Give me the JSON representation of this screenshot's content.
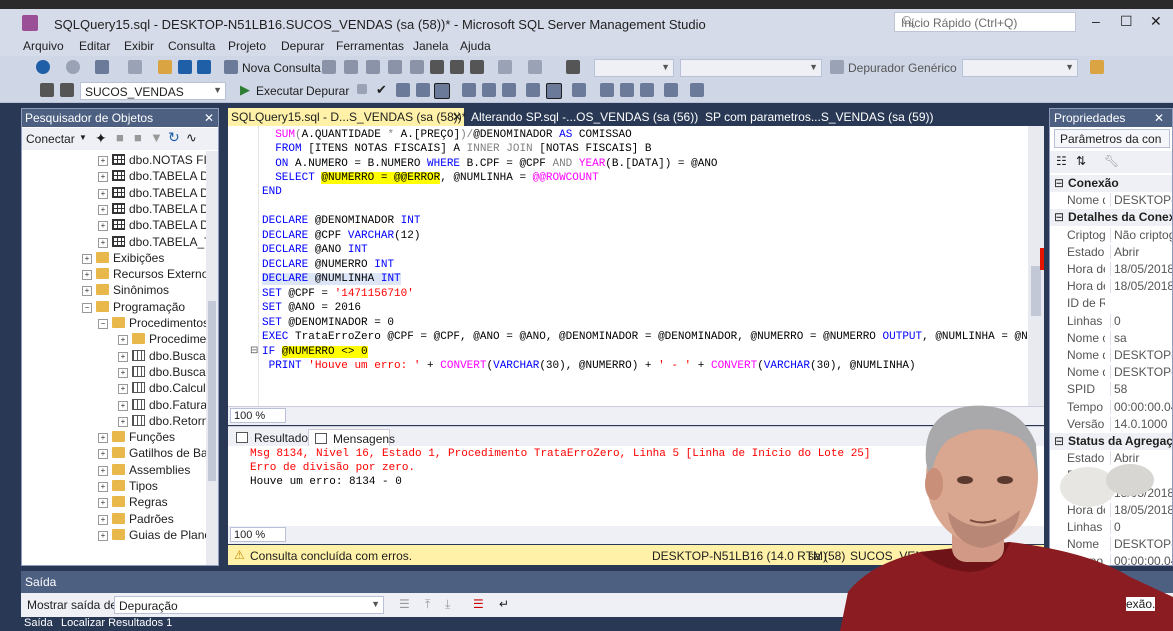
{
  "window": {
    "title": "SQLQuery15.sql - DESKTOP-N51LB16.SUCOS_VENDAS (sa (58))* - Microsoft SQL Server Management Studio",
    "quick_launch_placeholder": "Início Rápido (Ctrl+Q)"
  },
  "menu": [
    "Arquivo",
    "Editar",
    "Exibir",
    "Consulta",
    "Projeto",
    "Depurar",
    "Ferramentas",
    "Janela",
    "Ajuda"
  ],
  "toolbar": {
    "new_query": "Nova Consulta",
    "debugger": "Depurador Genérico",
    "database": "SUCOS_VENDAS",
    "execute": "Executar",
    "debug": "Depurar"
  },
  "object_explorer": {
    "title": "Pesquisador de Objetos",
    "connect": "Conectar",
    "nodes": [
      {
        "label": "dbo.NOTAS FIS",
        "icon": "table"
      },
      {
        "label": "dbo.TABELA DE",
        "icon": "table"
      },
      {
        "label": "dbo.TABELA DE",
        "icon": "table"
      },
      {
        "label": "dbo.TABELA DE",
        "icon": "table"
      },
      {
        "label": "dbo.TABELA DE",
        "icon": "table"
      },
      {
        "label": "dbo.TABELA_TE",
        "icon": "table"
      },
      {
        "label": "Exibições",
        "icon": "folder"
      },
      {
        "label": "Recursos Externos",
        "icon": "folder"
      },
      {
        "label": "Sinônimos",
        "icon": "folder"
      },
      {
        "label": "Programação",
        "icon": "folder"
      },
      {
        "label": "Procedimentos",
        "icon": "folder"
      },
      {
        "label": "Procedimen",
        "icon": "folder"
      },
      {
        "label": "dbo.BuscaN",
        "icon": "proc"
      },
      {
        "label": "dbo.BuscaP",
        "icon": "proc"
      },
      {
        "label": "dbo.Calcula",
        "icon": "proc"
      },
      {
        "label": "dbo.Faturan",
        "icon": "proc"
      },
      {
        "label": "dbo.Retorna",
        "icon": "proc"
      },
      {
        "label": "Funções",
        "icon": "folder"
      },
      {
        "label": "Gatilhos de Ban",
        "icon": "folder"
      },
      {
        "label": "Assemblies",
        "icon": "folder"
      },
      {
        "label": "Tipos",
        "icon": "folder"
      },
      {
        "label": "Regras",
        "icon": "folder"
      },
      {
        "label": "Padrões",
        "icon": "folder"
      },
      {
        "label": "Guias de Plano",
        "icon": "folder"
      }
    ]
  },
  "tabs": [
    {
      "label": "SQLQuery15.sql - D...S_VENDAS (sa (58))*",
      "active": true
    },
    {
      "label": "Alterando SP.sql -...OS_VENDAS (sa (56))",
      "active": false
    },
    {
      "label": "SP com parametros...S_VENDAS (sa (59))",
      "active": false
    }
  ],
  "editor": {
    "zoom": "100 %",
    "lines": {
      "l1a": "SUM(A.QUANTIDADE * A.[PREÇO])/@DENOMINADOR AS COMISSAO",
      "l2_kw": "FROM",
      "l2a": " [ITENS NOTAS FISCAIS] A ",
      "l2_kw2": "INNER JOIN",
      "l2b": " [NOTAS FISCAIS] B",
      "l3_kw": "ON",
      "l3a": " A.NUMERO = B.NUMERO ",
      "l3_kw2": "WHERE",
      "l3b": " B.CPF = @CPF ",
      "l3_kw3": "AND",
      "l3_fn": "YEAR",
      "l3c": "(B.[DATA]) = @ANO",
      "l4_kw": "SELECT",
      "l4_hl1": "@NUMERRO = @@ERROR",
      "l4a": ", @NUMLINHA = ",
      "l4_fn": "@@ROWCOUNT",
      "l5": "END",
      "d1": "@DENOMINADOR",
      "d1t": "INT",
      "d2": "@CPF",
      "d2t": "VARCHAR",
      "d2s": "(12)",
      "d3": "@ANO",
      "d3t": "INT",
      "d4": "@NUMERRO",
      "d4t": "INT",
      "d5": "@NUMLINHA",
      "d5t": "INT",
      "declare": "DECLARE",
      "set": "SET",
      "s1a": " @CPF = ",
      "s1s": "'1471156710'",
      "s2": " @ANO = 2016",
      "s3": " @DENOMINADOR = 0",
      "exec_kw": "EXEC",
      "exec_a": " TrataErroZero @CPF = @CPF, @ANO = @ANO, @DENOMINADOR = @DENOMINADOR, @NUMERRO = @NUMERRO ",
      "exec_kw2": "OUTPUT",
      "exec_b": ", @NUMLINHA = @NUMLIN",
      "if_kw": "IF",
      "if_hl": "@NUMERRO <> 0",
      "print_kw": "PRINT",
      "print_s": "'Houve um erro: '",
      "print_a": " + ",
      "conv": "CONVERT",
      "varchar": "VARCHAR",
      "p30": "(30), @NUMERRO) + ",
      "dash": "' - '",
      "p30b": "(30), @NUMLINHA)"
    }
  },
  "results": {
    "tab_results": "Resultados",
    "tab_messages": "Mensagens",
    "zoom": "100 %",
    "messages": [
      "Msg 8134, Nível 16, Estado 1, Procedimento TrataErroZero, Linha 5 [Linha de Início do Lote 25]",
      "Erro de divisão por zero.",
      "Houve um erro: 8134 - 0"
    ]
  },
  "status": {
    "text": "Consulta concluída com erros.",
    "server": "DESKTOP-N51LB16 (14.0 RTM)",
    "user": "sa (58)",
    "db": "SUCOS_VENDAS"
  },
  "properties": {
    "title": "Propriedades",
    "selector": "Parâmetros da con",
    "rows": [
      {
        "type": "cat",
        "label": "Conexão"
      },
      {
        "type": "row",
        "k": "Nome d",
        "v": "DESKTOP-N"
      },
      {
        "type": "cat",
        "label": "Detalhes da Conexão"
      },
      {
        "type": "row",
        "k": "Criptog",
        "v": "Não criptog"
      },
      {
        "type": "row",
        "k": "Estado d",
        "v": "Abrir"
      },
      {
        "type": "row",
        "k": "Hora de",
        "v": "18/05/2018"
      },
      {
        "type": "row",
        "k": "Hora de",
        "v": "18/05/2018"
      },
      {
        "type": "row",
        "k": "ID de Ra",
        "v": ""
      },
      {
        "type": "row",
        "k": "Linhas r",
        "v": "0"
      },
      {
        "type": "row",
        "k": "Nome c",
        "v": "sa"
      },
      {
        "type": "row",
        "k": "Nome d",
        "v": "DESKTOP-N"
      },
      {
        "type": "row",
        "k": "Nome d",
        "v": "DESKTOP-N"
      },
      {
        "type": "row",
        "k": "SPID",
        "v": "58"
      },
      {
        "type": "row",
        "k": "Tempo",
        "v": "00:00:00.045"
      },
      {
        "type": "row",
        "k": "Versão d",
        "v": "14.0.1000"
      },
      {
        "type": "cat",
        "label": "Status da Agregação"
      },
      {
        "type": "row",
        "k": "Estado",
        "v": "Abrir"
      },
      {
        "type": "row",
        "k": "Falhas d",
        "v": ""
      },
      {
        "type": "row",
        "k": "Hora de",
        "v": "18/05/2018"
      },
      {
        "type": "row",
        "k": "Hora de",
        "v": "18/05/2018"
      },
      {
        "type": "row",
        "k": "Linhas r",
        "v": "0"
      },
      {
        "type": "row",
        "k": "Nome",
        "v": "DESKTOP-N"
      },
      {
        "type": "row",
        "k": "Tempo",
        "v": "00:00:00.045"
      }
    ],
    "bottom_text": "exão."
  },
  "output": {
    "title": "Saída",
    "show_from_label": "Mostrar saída de:",
    "show_from_value": "Depuração",
    "bottom_tabs": [
      "Saída",
      "Localizar Resultados 1"
    ]
  },
  "colors": {
    "highlight": "#ffff00",
    "keyword": "#0000ff",
    "string": "#ff0000",
    "function": "#ff00ff",
    "error_msg": "#ff0000",
    "status_bar": "#fff1a8"
  }
}
